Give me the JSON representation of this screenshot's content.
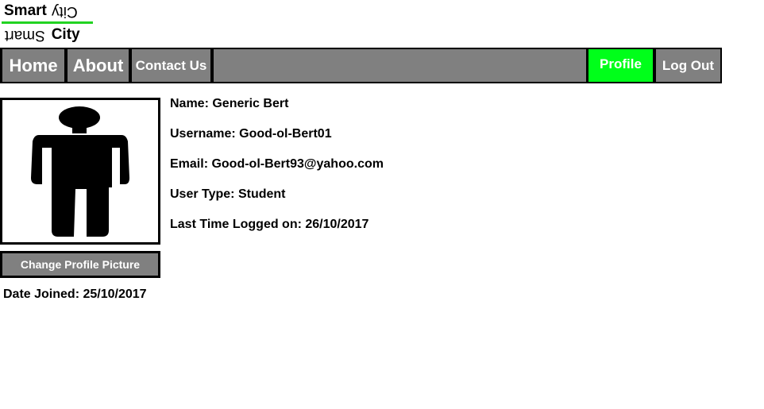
{
  "logo": {
    "top_bold": "Smart",
    "top_flipped": "City",
    "bottom_flipped": "Smart",
    "bottom_bold": "City",
    "accent": "#22d322"
  },
  "nav": {
    "home": "Home",
    "about": "About",
    "contact": "Contact Us",
    "profile": "Profile",
    "logout": "Log Out",
    "bg": "#808080",
    "active_bg": "#00ff1a"
  },
  "profile": {
    "avatar_icon": "person-icon",
    "change_picture_label": "Change Profile Picture",
    "date_joined": "Date Joined: 25/10/2017",
    "fields": [
      "Name: Generic Bert",
      "Username: Good-ol-Bert01",
      "Email: Good-ol-Bert93@yahoo.com",
      "User Type: Student",
      "Last Time Logged on: 26/10/2017"
    ]
  }
}
